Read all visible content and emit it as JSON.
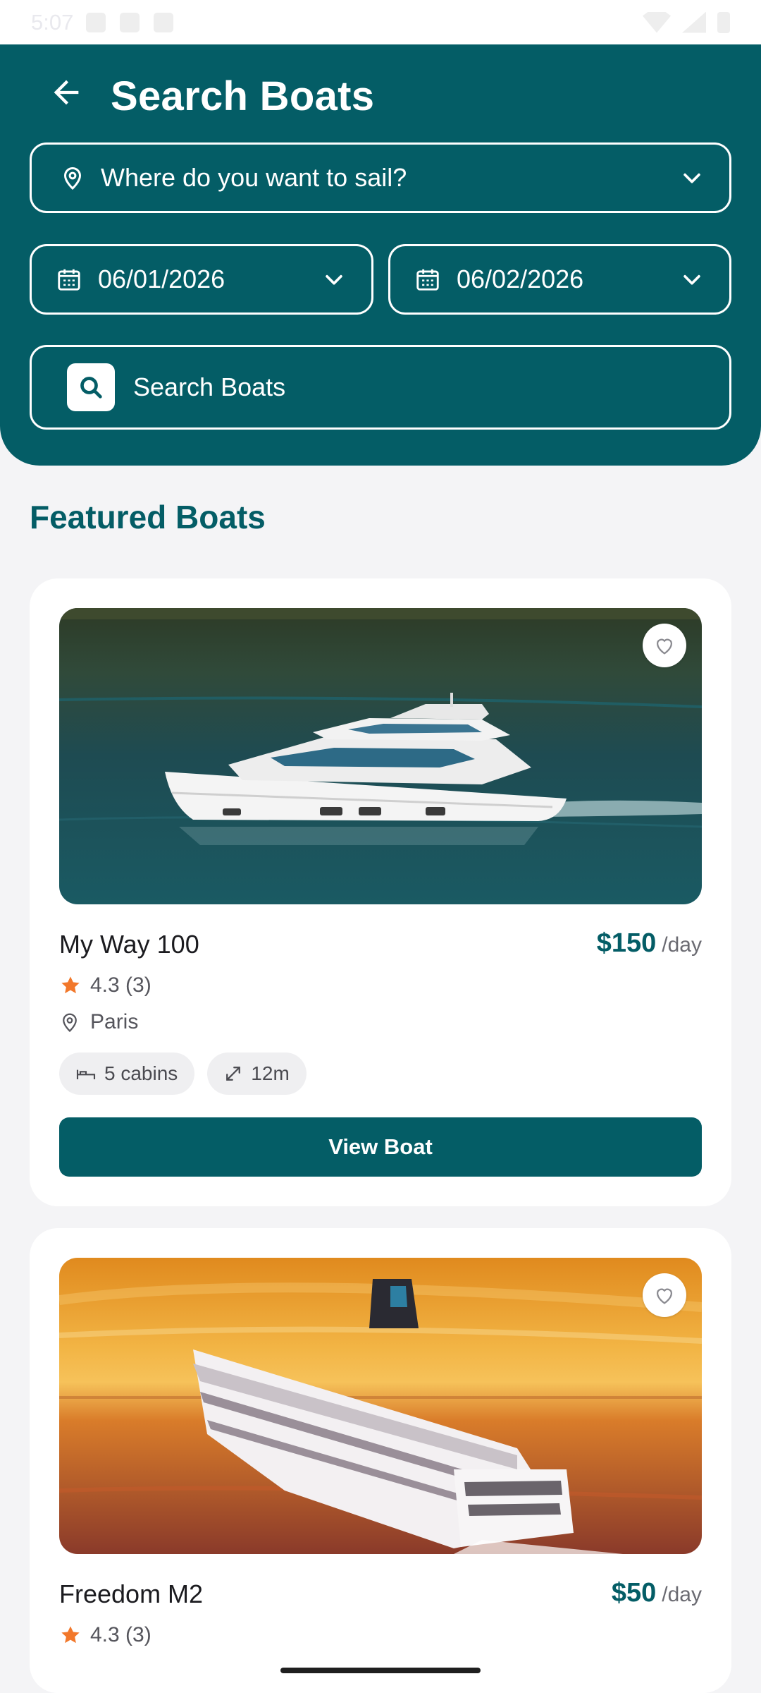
{
  "status_bar": {
    "time": "5:07"
  },
  "header": {
    "title": "Search Boats",
    "location_placeholder": "Where do you want to sail?",
    "date_from": "06/01/2026",
    "date_to": "06/02/2026",
    "search_label": "Search Boats"
  },
  "section_title": "Featured Boats",
  "boats": [
    {
      "name": "My Way 100",
      "price": "$150",
      "price_unit": "/day",
      "rating": "4.3 (3)",
      "location": "Paris",
      "cabins": "5 cabins",
      "length": "12m",
      "button": "View Boat"
    },
    {
      "name": "Freedom M2",
      "price": "$50",
      "price_unit": "/day",
      "rating": "4.3 (3)"
    }
  ],
  "colors": {
    "primary": "#045d66",
    "star": "#f2782b",
    "background": "#f4f4f6"
  }
}
